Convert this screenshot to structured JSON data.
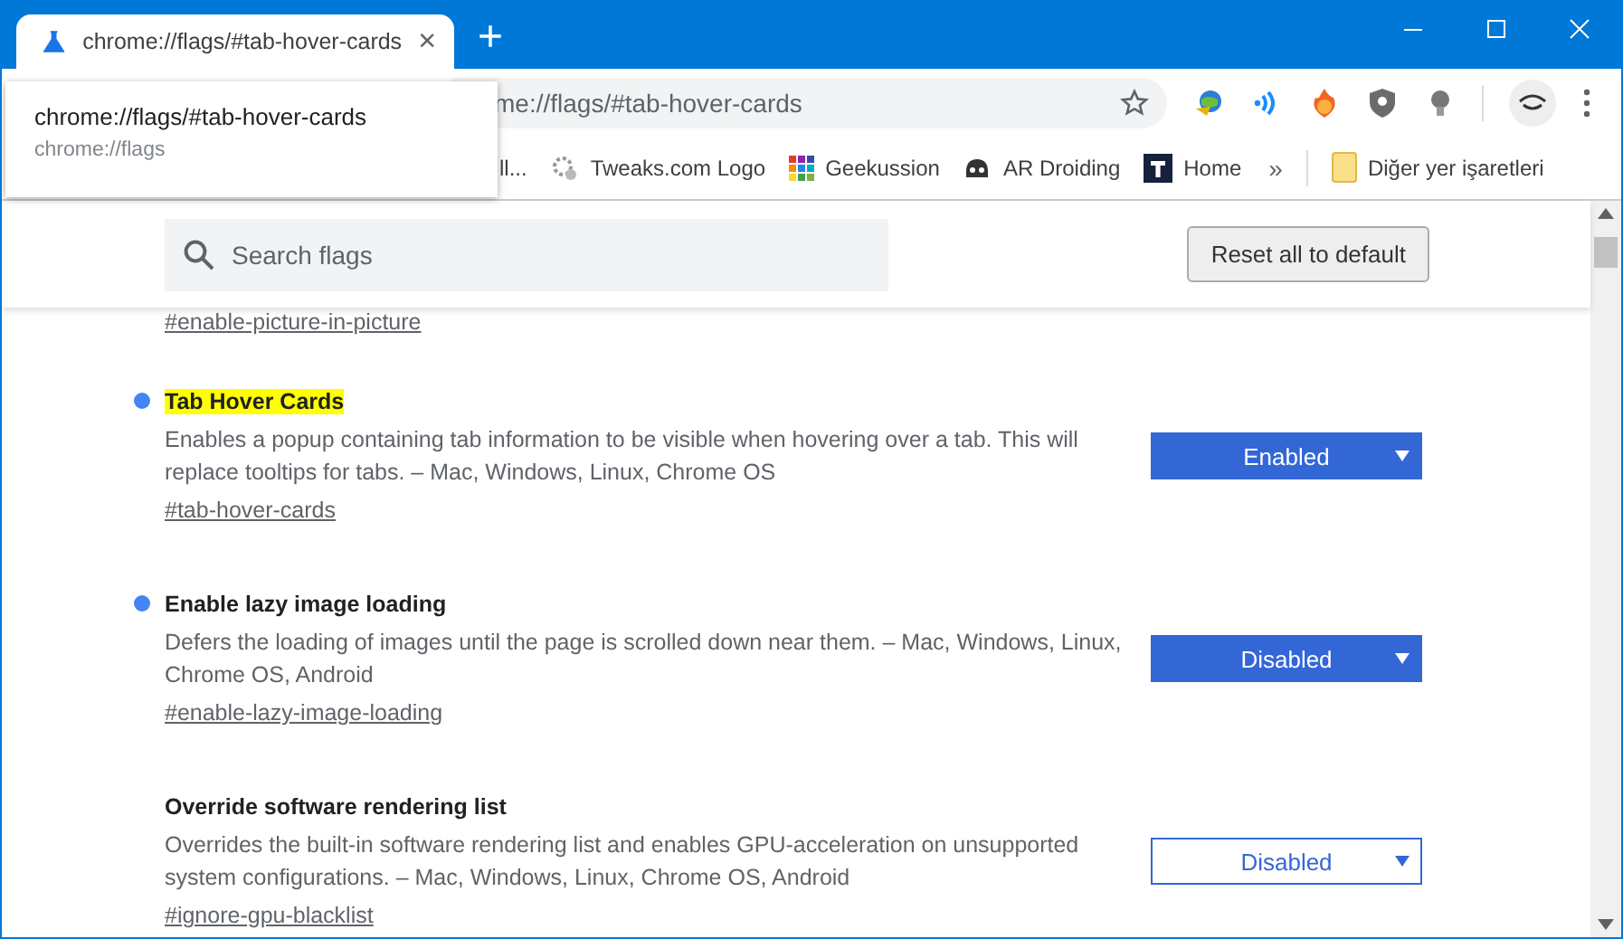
{
  "tab": {
    "title": "chrome://flags/#tab-hover-cards",
    "close": "×"
  },
  "new_tab": "+",
  "hover_card": {
    "title": "chrome://flags/#tab-hover-cards",
    "url": "chrome://flags"
  },
  "omnibox": {
    "text": "me://flags/#tab-hover-cards"
  },
  "bookmarks": [
    {
      "label": "ll..."
    },
    {
      "label": "Tweaks.com Logo"
    },
    {
      "label": "Geekussion"
    },
    {
      "label": "AR Droiding"
    },
    {
      "label": "Home"
    }
  ],
  "bookmarks_overflow": "»",
  "other_bookmarks": "Diğer yer işaretleri",
  "search": {
    "placeholder": "Search flags"
  },
  "reset_button": "Reset all to default",
  "cut_link": "#enable-picture-in-picture",
  "flags": [
    {
      "title": "Tab Hover Cards",
      "highlighted": true,
      "modified": true,
      "description": "Enables a popup containing tab information to be visible when hovering over a tab. This will replace tooltips for tabs. – Mac, Windows, Linux, Chrome OS",
      "link": "#tab-hover-cards",
      "value": "Enabled"
    },
    {
      "title": "Enable lazy image loading",
      "highlighted": false,
      "modified": true,
      "description": "Defers the loading of images until the page is scrolled down near them. – Mac, Windows, Linux, Chrome OS, Android",
      "link": "#enable-lazy-image-loading",
      "value": "Disabled"
    },
    {
      "title": "Override software rendering list",
      "highlighted": false,
      "modified": false,
      "description": "Overrides the built-in software rendering list and enables GPU-acceleration on unsupported system configurations. – Mac, Windows, Linux, Chrome OS, Android",
      "link": "#ignore-gpu-blacklist",
      "value": "Disabled"
    }
  ]
}
